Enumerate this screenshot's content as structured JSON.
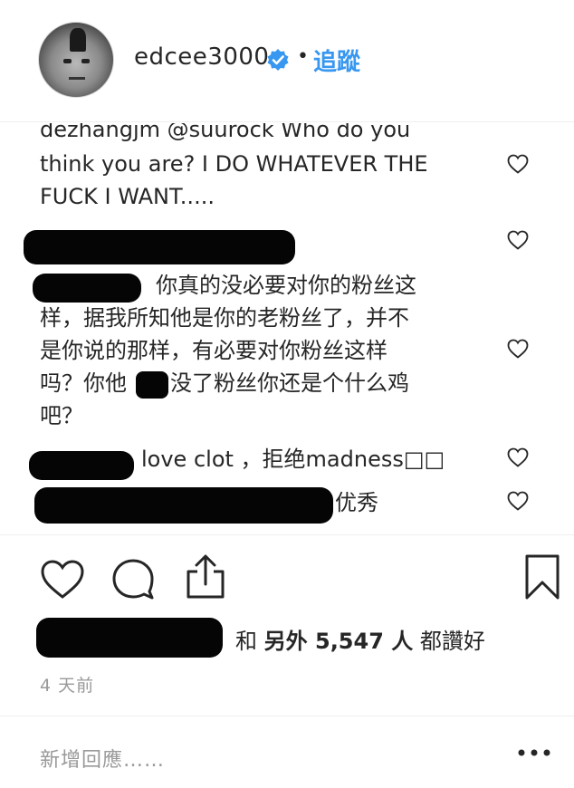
{
  "header": {
    "username": "edcee3000",
    "separator": "•",
    "follow_label": "追蹤"
  },
  "comments": [
    {
      "line1": "dezhangjm @suurock Who do you",
      "line2": "think you are? I DO WHATEVER THE",
      "line3": "FUCK I WANT....."
    },
    {
      "text": ""
    },
    {
      "line1": "你真的没必要对你的粉丝这",
      "line2": "样，据我所知他是你的老粉丝了，并不",
      "line3": "是你说的那样，有必要对你粉丝这样",
      "line4a": "吗？你他",
      "line4b": "没了粉丝你还是个什么鸡",
      "line5": "吧？"
    },
    {
      "text": "love clot ，拒绝madness□□"
    },
    {
      "text": "优秀"
    }
  ],
  "likes": {
    "and": "和",
    "others": "另外 5,547 人",
    "suffix": "都讚好"
  },
  "timestamp": "4 天前",
  "add_comment": {
    "placeholder": "新增回應……"
  },
  "icons": {
    "verified": "verified-badge-icon",
    "heart": "heart-icon",
    "comment": "comment-bubble-icon",
    "share": "share-upload-icon",
    "save": "bookmark-icon",
    "more": "more-options-icon"
  },
  "colors": {
    "accent": "#3897f0",
    "text": "#262626",
    "muted": "#999999",
    "redaction": "#050505"
  }
}
